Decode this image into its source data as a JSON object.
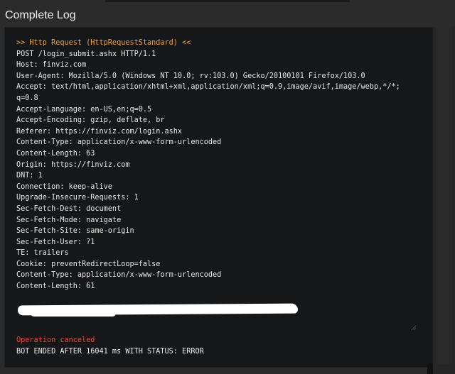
{
  "title": "Complete Log",
  "log": {
    "lines": [
      ">> Http Request (HttpRequestStandard) <<",
      "POST /login_submit.ashx HTTP/1.1",
      "Host: finviz.com",
      "User-Agent: Mozilla/5.0 (Windows NT 10.0; rv:103.0) Gecko/20100101 Firefox/103.0",
      "Accept: text/html,application/xhtml+xml,application/xml;q=0.9,image/avif,image/webp,*/*;",
      "q=0.8",
      "Accept-Language: en-US,en;q=0.5",
      "Accept-Encoding: gzip, deflate, br",
      "Referer: https://finviz.com/login.ashx",
      "Content-Type: application/x-www-form-urlencoded",
      "Content-Length: 63",
      "Origin: https://finviz.com",
      "DNT: 1",
      "Connection: keep-alive",
      "Upgrade-Insecure-Requests: 1",
      "Sec-Fetch-Dest: document",
      "Sec-Fetch-Mode: navigate",
      "Sec-Fetch-Site: same-origin",
      "Sec-Fetch-User: ?1",
      "TE: trailers",
      "Cookie: preventRedirectLoop=false",
      "Content-Type: application/x-www-form-urlencoded",
      "Content-Length: 61"
    ],
    "error_line": "Operation canceled",
    "end_line": "BOT ENDED AFTER 16041 ms WITH STATUS: ERROR"
  },
  "colors": {
    "background": "#2b2b2b",
    "panel": "#161719",
    "header_text": "#f0a040",
    "error_text": "#e8453c",
    "log_text": "#e8e8e8"
  }
}
